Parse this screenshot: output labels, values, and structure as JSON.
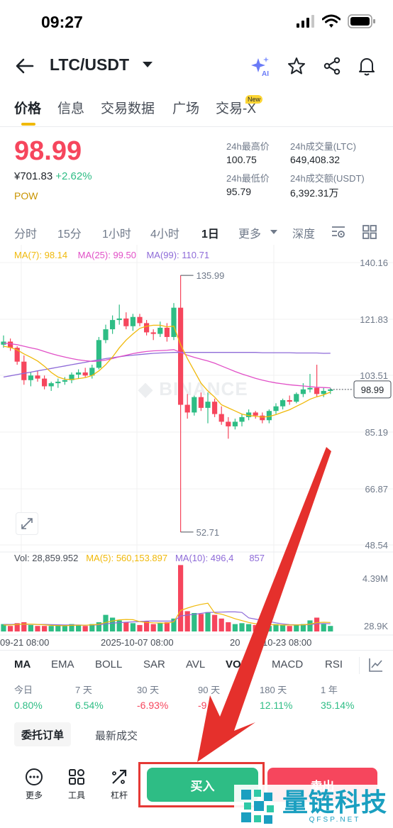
{
  "status": {
    "time": "09:27"
  },
  "nav": {
    "pair": "LTC/USDT"
  },
  "tabs": [
    {
      "label": "价格"
    },
    {
      "label": "信息"
    },
    {
      "label": "交易数据"
    },
    {
      "label": "广场"
    },
    {
      "label": "交易-X"
    }
  ],
  "new_badge": "New",
  "ticker": {
    "price": "98.99",
    "fiat": "¥701.83",
    "change": "+2.62%",
    "tag": "POW",
    "high_label": "24h最高价",
    "high": "100.75",
    "low_label": "24h最低价",
    "low": "95.79",
    "vol_label": "24h成交量(LTC)",
    "vol": "649,408.32",
    "turnover_label": "24h成交额(USDT)",
    "turnover": "6,392.31万"
  },
  "intervals": [
    "分时",
    "15分",
    "1小时",
    "4小时",
    "1日",
    "更多",
    "深度"
  ],
  "ma_legend": {
    "ma7": "MA(7): 98.14",
    "ma25": "MA(25): 99.50",
    "ma99": "MA(99): 110.71"
  },
  "vol_legend": {
    "vol": "Vol: 28,859.952",
    "ma5": "MA(5): 560,153.897",
    "ma10": "MA(10): 496,4"
  },
  "vol_legend_tail": "857",
  "watermark_center": "BINANCE",
  "chart_data": {
    "type": "candlestick",
    "y_ticks": [
      "140.16",
      "121.83",
      "103.51",
      "85.19",
      "66.87",
      "48.54"
    ],
    "ylim": [
      48.54,
      140.16
    ],
    "x_ticks": [
      "09-21 08:00",
      "2025-10-07 08:00",
      "2025-10-23 08:00"
    ],
    "x_ticks_visible": [
      "09-21 08:00",
      "2025-10-07 08:00",
      "20",
      "10-23 08:00"
    ],
    "current_price": "98.99",
    "high_annotation": "135.99",
    "low_annotation": "52.71",
    "volume_ticks": [
      "4.39M",
      "28.9K"
    ],
    "colors": {
      "up": "#2ebd85",
      "down": "#f6465d",
      "ma7": "#f0b90b",
      "ma25": "#e150c7",
      "ma99": "#8e6bd8"
    },
    "candles": [
      [
        113.5,
        116.5,
        112.5,
        114.5
      ],
      [
        114.5,
        115.5,
        111.5,
        112.5
      ],
      [
        112.5,
        113.0,
        107.0,
        108.0
      ],
      [
        108.0,
        110.0,
        100.5,
        102.0
      ],
      [
        102.0,
        104.5,
        100.0,
        103.5
      ],
      [
        103.5,
        105.0,
        101.5,
        102.5
      ],
      [
        102.5,
        103.5,
        99.0,
        100.0
      ],
      [
        100.0,
        101.5,
        98.5,
        101.0
      ],
      [
        101.0,
        102.5,
        99.5,
        101.5
      ],
      [
        101.5,
        103.0,
        100.5,
        102.0
      ],
      [
        102.0,
        104.5,
        101.0,
        103.8
      ],
      [
        103.8,
        105.5,
        102.5,
        104.5
      ],
      [
        104.5,
        106.0,
        103.0,
        103.5
      ],
      [
        103.5,
        107.0,
        102.5,
        106.0
      ],
      [
        106.0,
        116.0,
        105.5,
        115.0
      ],
      [
        115.0,
        120.0,
        114.0,
        118.5
      ],
      [
        118.5,
        123.0,
        117.0,
        121.5
      ],
      [
        121.5,
        126.5,
        120.0,
        122.0
      ],
      [
        122.0,
        124.0,
        118.5,
        119.5
      ],
      [
        119.5,
        123.5,
        118.0,
        122.5
      ],
      [
        122.5,
        123.5,
        119.5,
        120.5
      ],
      [
        120.5,
        121.5,
        116.5,
        117.5
      ],
      [
        117.5,
        118.5,
        115.0,
        117.0
      ],
      [
        117.0,
        121.0,
        116.0,
        119.0
      ],
      [
        119.0,
        120.5,
        114.5,
        116.0
      ],
      [
        116.0,
        127.0,
        115.0,
        125.5
      ],
      [
        125.5,
        135.99,
        52.71,
        94.0
      ],
      [
        94.0,
        97.5,
        89.5,
        91.5
      ],
      [
        91.5,
        97.0,
        90.5,
        96.5
      ],
      [
        96.5,
        98.0,
        92.0,
        93.0
      ],
      [
        93.0,
        98.0,
        88.0,
        95.0
      ],
      [
        95.0,
        96.0,
        90.0,
        91.0
      ],
      [
        91.0,
        93.5,
        87.5,
        88.5
      ],
      [
        88.5,
        90.0,
        83.0,
        87.0
      ],
      [
        87.0,
        89.5,
        86.0,
        88.5
      ],
      [
        88.5,
        91.0,
        87.0,
        90.0
      ],
      [
        90.0,
        92.5,
        89.0,
        91.5
      ],
      [
        91.5,
        92.0,
        89.5,
        90.5
      ],
      [
        90.5,
        91.5,
        88.0,
        89.0
      ],
      [
        89.0,
        92.5,
        88.0,
        92.0
      ],
      [
        92.0,
        94.5,
        91.0,
        93.5
      ],
      [
        93.5,
        96.0,
        92.5,
        95.5
      ],
      [
        95.5,
        97.0,
        94.0,
        95.0
      ],
      [
        95.0,
        98.0,
        94.5,
        97.5
      ],
      [
        97.5,
        101.0,
        96.5,
        99.0
      ],
      [
        99.0,
        104.0,
        98.0,
        99.5
      ],
      [
        99.5,
        107.0,
        96.5,
        97.5
      ],
      [
        97.5,
        99.5,
        96.5,
        98.5
      ],
      [
        98.5,
        99.5,
        97.5,
        98.99
      ]
    ],
    "ma7": [
      113.0,
      112.6,
      111.8,
      110.5,
      109.4,
      108.2,
      106.5,
      104.5,
      103.0,
      102.3,
      102.2,
      102.5,
      102.8,
      103.5,
      105.0,
      107.0,
      109.5,
      112.5,
      115.0,
      117.0,
      118.8,
      119.5,
      119.8,
      119.8,
      119.3,
      119.5,
      113.5,
      109.0,
      105.0,
      101.0,
      98.5,
      96.5,
      94.0,
      93.0,
      92.0,
      91.0,
      90.5,
      90.3,
      90.0,
      90.2,
      90.8,
      91.6,
      92.4,
      93.5,
      94.6,
      95.8,
      96.6,
      97.2,
      98.14
    ],
    "ma25": [
      114.0,
      113.8,
      113.5,
      113.0,
      112.5,
      112.0,
      111.3,
      110.6,
      110.0,
      109.5,
      109.0,
      108.6,
      108.3,
      108.1,
      108.2,
      108.5,
      109.0,
      109.6,
      110.1,
      110.6,
      111.0,
      111.3,
      111.5,
      111.6,
      111.7,
      111.9,
      111.0,
      110.1,
      109.4,
      108.8,
      108.2,
      107.5,
      106.6,
      105.7,
      104.8,
      104.0,
      103.3,
      102.6,
      102.0,
      101.5,
      101.1,
      100.8,
      100.5,
      100.3,
      100.1,
      99.9,
      99.7,
      99.6,
      99.5
    ],
    "ma99": [
      103.0,
      103.4,
      103.8,
      104.2,
      104.6,
      105.0,
      105.4,
      105.8,
      106.2,
      106.6,
      107.0,
      107.4,
      107.8,
      108.2,
      108.6,
      109.0,
      109.3,
      109.6,
      109.9,
      110.1,
      110.3,
      110.5,
      110.7,
      110.8,
      110.9,
      111.0,
      111.0,
      111.0,
      111.0,
      111.0,
      111.0,
      111.0,
      111.0,
      111.0,
      111.0,
      111.0,
      111.0,
      111.0,
      110.9,
      110.9,
      110.9,
      110.9,
      110.9,
      110.8,
      110.8,
      110.8,
      110.8,
      110.7,
      110.71
    ],
    "volumes": [
      0.4,
      0.3,
      0.45,
      0.5,
      0.35,
      0.3,
      0.3,
      0.3,
      0.35,
      0.3,
      0.4,
      0.35,
      0.3,
      0.4,
      0.5,
      0.9,
      0.75,
      0.6,
      0.5,
      0.45,
      0.35,
      0.55,
      0.4,
      0.45,
      0.5,
      0.7,
      3.6,
      1.1,
      1.0,
      0.95,
      1.05,
      0.9,
      0.7,
      0.5,
      0.4,
      0.45,
      0.4,
      0.35,
      0.35,
      0.3,
      0.4,
      0.35,
      0.3,
      0.35,
      0.4,
      0.6,
      0.75,
      0.4,
      0.3
    ],
    "vol_ma5": [
      0.35,
      0.35,
      0.38,
      0.4,
      0.4,
      0.38,
      0.36,
      0.33,
      0.32,
      0.31,
      0.33,
      0.34,
      0.34,
      0.36,
      0.39,
      0.49,
      0.57,
      0.63,
      0.65,
      0.64,
      0.53,
      0.49,
      0.47,
      0.46,
      0.45,
      0.52,
      1.14,
      1.27,
      1.38,
      1.47,
      1.53,
      1.0,
      0.94,
      0.82,
      0.69,
      0.59,
      0.49,
      0.42,
      0.39,
      0.37,
      0.36,
      0.35,
      0.35,
      0.35,
      0.36,
      0.4,
      0.48,
      0.5,
      0.49
    ],
    "vol_ma10": [
      0.38,
      0.38,
      0.39,
      0.39,
      0.39,
      0.38,
      0.38,
      0.37,
      0.36,
      0.35,
      0.35,
      0.35,
      0.34,
      0.35,
      0.36,
      0.41,
      0.45,
      0.48,
      0.5,
      0.52,
      0.54,
      0.56,
      0.57,
      0.56,
      0.56,
      0.56,
      0.84,
      0.89,
      0.93,
      0.98,
      1.03,
      1.04,
      1.05,
      1.06,
      1.06,
      1.03,
      0.74,
      0.67,
      0.6,
      0.54,
      0.47,
      0.41,
      0.37,
      0.36,
      0.36,
      0.37,
      0.42,
      0.43,
      0.42
    ]
  },
  "indicators": [
    "MA",
    "EMA",
    "BOLL",
    "SAR",
    "AVL",
    "VOL",
    "MACD",
    "RSI"
  ],
  "performance": [
    {
      "label": "今日",
      "value": "0.80%",
      "color": "#2ebd85"
    },
    {
      "label": "7 天",
      "value": "6.54%",
      "color": "#2ebd85"
    },
    {
      "label": "30 天",
      "value": "-6.93%",
      "color": "#f6465d"
    },
    {
      "label": "90 天",
      "value": "-9",
      "color": "#f6465d"
    },
    {
      "label": "180 天",
      "value": "12.11%",
      "color": "#2ebd85"
    },
    {
      "label": "1 年",
      "value": "35.14%",
      "color": "#2ebd85"
    }
  ],
  "order_tabs": {
    "orders": "委托订单",
    "trades": "最新成交"
  },
  "bottom": {
    "more": "更多",
    "tools": "工具",
    "leverage": "杠杆",
    "buy": "买入",
    "sell": "卖出"
  },
  "overlay_watermark": {
    "cn": "量链科技",
    "en": "QFSP.NET"
  }
}
